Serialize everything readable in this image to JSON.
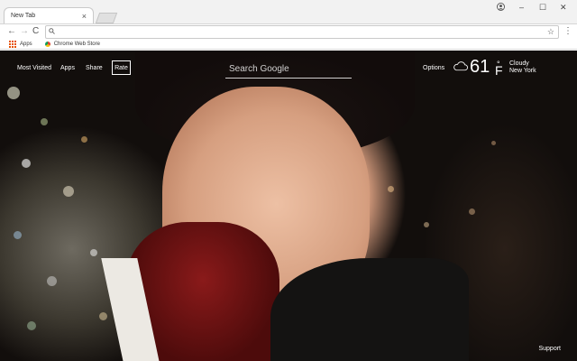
{
  "browser": {
    "tab_title": "New Tab",
    "tab_close": "×",
    "window_controls": [
      "–",
      "☐",
      "✕"
    ],
    "profile_icon": "account-circle-icon",
    "nav": {
      "back": "←",
      "forward": "→",
      "reload": "C"
    },
    "omnibox": {
      "value": "",
      "placeholder": ""
    },
    "bookmarks": [
      {
        "label": "Apps",
        "icon": "apps-grid-icon"
      },
      {
        "label": "Chrome Web Store",
        "icon": "chrome-store-icon"
      }
    ]
  },
  "newtab": {
    "links": [
      "Most Visited",
      "Apps",
      "Share"
    ],
    "rate_label": "Rate",
    "search_placeholder": "Search Google",
    "options_label": "Options",
    "weather": {
      "temp": "61",
      "degree": "°",
      "unit": "F",
      "condition": "Cloudy",
      "location": "New York"
    },
    "support_label": "Support"
  }
}
